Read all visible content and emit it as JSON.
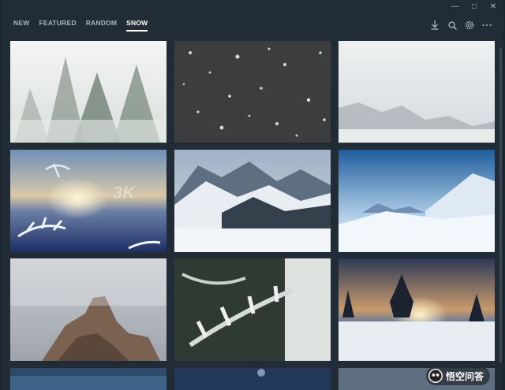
{
  "window": {
    "controls": [
      "—",
      "□",
      "✕"
    ]
  },
  "nav": {
    "tabs": [
      {
        "label": "NEW",
        "active": false
      },
      {
        "label": "FEATURED",
        "active": false
      },
      {
        "label": "RANDOM",
        "active": false
      },
      {
        "label": "SNOW",
        "active": true
      }
    ]
  },
  "actions": [
    {
      "name": "download-icon"
    },
    {
      "name": "search-icon"
    },
    {
      "name": "settings-icon"
    },
    {
      "name": "more-icon"
    }
  ],
  "grid": {
    "tiles": [
      {
        "name": "snowy-pine-trees"
      },
      {
        "name": "falling-snowflakes"
      },
      {
        "name": "misty-winter-forest"
      },
      {
        "name": "frosted-branch-sunset",
        "watermark": "3K"
      },
      {
        "name": "snowy-mountain-valley"
      },
      {
        "name": "blue-sky-snow-peak"
      },
      {
        "name": "foggy-rock-spire"
      },
      {
        "name": "snow-covered-pine-branch"
      },
      {
        "name": "winter-sunset-field"
      },
      {
        "name": "partial-tile-1"
      },
      {
        "name": "partial-tile-2"
      },
      {
        "name": "partial-tile-3"
      }
    ]
  },
  "watermark": {
    "text": "悟空问答"
  },
  "colors": {
    "background": "#222c36",
    "active_tab": "#ffffff",
    "tab": "#a9b4bf"
  }
}
